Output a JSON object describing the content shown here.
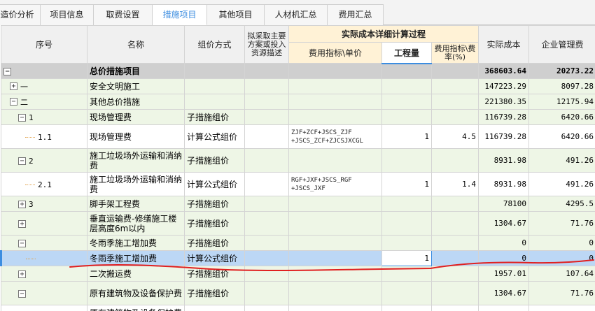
{
  "tabs": [
    {
      "label": "造价分析",
      "active": false
    },
    {
      "label": "项目信息",
      "active": false
    },
    {
      "label": "取费设置",
      "active": false
    },
    {
      "label": "措施项目",
      "active": true
    },
    {
      "label": "其他项目",
      "active": false
    },
    {
      "label": "人材机汇总",
      "active": false
    },
    {
      "label": "费用汇总",
      "active": false
    }
  ],
  "header": {
    "seq": "序号",
    "name": "名称",
    "method": "组价方式",
    "plan": "拟采取主要方案或投入资源描述",
    "group": "实际成本详细计算过程",
    "index_unit": "费用指标\\单价",
    "quantity": "工程量",
    "rate": "费用指标\\费率(%)",
    "actual_cost": "实际成本",
    "mgmt_fee": "企业管理费"
  },
  "rows": [
    {
      "toggle": "−",
      "seq": "",
      "name": "总价措施项目",
      "method": "",
      "formula": "",
      "qty": "",
      "rate": "",
      "cost": "368603.64",
      "fee": "20273.22"
    },
    {
      "toggle": "+",
      "seq": "一",
      "name": "安全文明施工",
      "method": "",
      "formula": "",
      "qty": "",
      "rate": "",
      "cost": "147223.29",
      "fee": "8097.28"
    },
    {
      "toggle": "−",
      "seq": "二",
      "name": "其他总价措施",
      "method": "",
      "formula": "",
      "qty": "",
      "rate": "",
      "cost": "221380.35",
      "fee": "12175.94"
    },
    {
      "toggle": "−",
      "seq": "1",
      "name": "现场管理费",
      "method": "子措施组价",
      "formula": "",
      "qty": "",
      "rate": "",
      "cost": "116739.28",
      "fee": "6420.66"
    },
    {
      "toggle": "",
      "seq": "1.1",
      "name": "现场管理费",
      "method": "计算公式组价",
      "formula": "ZJF+ZCF+JSCS_ZJF +JSCS_ZCF+ZJCSJXCGL",
      "qty": "1",
      "rate": "4.5",
      "cost": "116739.28",
      "fee": "6420.66"
    },
    {
      "toggle": "−",
      "seq": "2",
      "name": "施工垃圾场外运输和消纳费",
      "method": "子措施组价",
      "formula": "",
      "qty": "",
      "rate": "",
      "cost": "8931.98",
      "fee": "491.26"
    },
    {
      "toggle": "",
      "seq": "2.1",
      "name": "施工垃圾场外运输和消纳费",
      "method": "计算公式组价",
      "formula": "RGF+JXF+JSCS_RGF +JSCS_JXF",
      "qty": "1",
      "rate": "1.4",
      "cost": "8931.98",
      "fee": "491.26"
    },
    {
      "toggle": "+",
      "seq": "3",
      "name": "脚手架工程费",
      "method": "子措施组价",
      "formula": "",
      "qty": "",
      "rate": "",
      "cost": "78100",
      "fee": "4295.5"
    },
    {
      "toggle": "+",
      "seq": "",
      "name": "垂直运输费-修缮施工楼层高度6m以内",
      "method": "子措施组价",
      "formula": "",
      "qty": "",
      "rate": "",
      "cost": "1304.67",
      "fee": "71.76"
    },
    {
      "toggle": "−",
      "seq": "",
      "name": "冬雨季施工增加费",
      "method": "子措施组价",
      "formula": "",
      "qty": "",
      "rate": "",
      "cost": "0",
      "fee": "0"
    },
    {
      "toggle": "",
      "seq": "",
      "name": "冬雨季施工增加费",
      "method": "计算公式组价",
      "formula": "",
      "qty": "1",
      "rate": "",
      "cost": "0",
      "fee": "0"
    },
    {
      "toggle": "+",
      "seq": "",
      "name": "二次搬运费",
      "method": "子措施组价",
      "formula": "",
      "qty": "",
      "rate": "",
      "cost": "1957.01",
      "fee": "107.64"
    },
    {
      "toggle": "−",
      "seq": "",
      "name": "原有建筑物及设备保护费",
      "method": "子措施组价",
      "formula": "",
      "qty": "",
      "rate": "",
      "cost": "1304.67",
      "fee": "71.76"
    },
    {
      "toggle": "",
      "seq": "",
      "name": "原有建筑物及设备保护费",
      "method": "",
      "formula": "",
      "qty": "",
      "rate": "",
      "cost": "",
      "fee": ""
    }
  ]
}
